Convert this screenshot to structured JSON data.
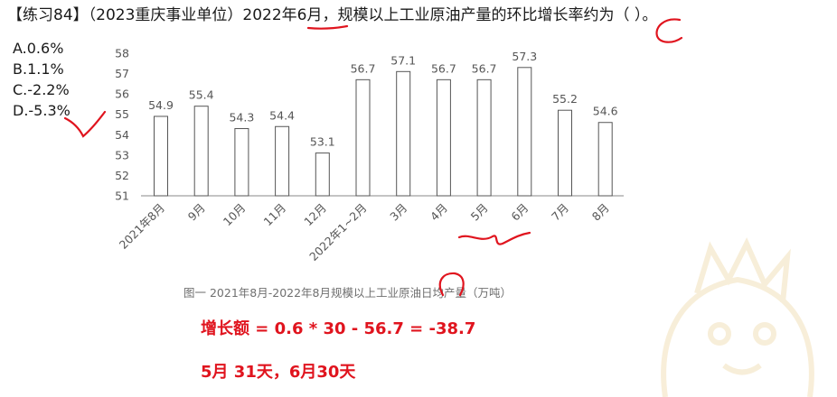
{
  "question": "【练习84】（2023重庆事业单位）2022年6月，规模以上工业原油产量的环比增长率约为（ ）。",
  "options": [
    "A.0.6%",
    "B.1.1%",
    "C.-2.2%",
    "D.-5.3%"
  ],
  "annotations": {
    "note1": "增长额 = 0.6 * 30 - 56.7 = -38.7",
    "note2": "5月 31天，6月30天",
    "color": "#e0141e"
  },
  "chart_data": {
    "type": "bar",
    "title": "图一  2021年8月-2022年8月规模以上工业原油日均产量（万吨）",
    "categories": [
      "2021年8月",
      "9月",
      "10月",
      "11月",
      "12月",
      "2022年1~2月",
      "3月",
      "4月",
      "5月",
      "6月",
      "7月",
      "8月"
    ],
    "values": [
      54.9,
      55.4,
      54.3,
      54.4,
      53.1,
      56.7,
      57.1,
      56.7,
      56.7,
      57.3,
      55.2,
      54.6
    ],
    "data_labels": [
      "54.9",
      "55.4",
      "54.3",
      "54.4",
      "53.1",
      "56.7",
      "57.1",
      "56.7",
      "56.7",
      "57.3",
      "55.2",
      "54.6"
    ],
    "ylim": [
      51,
      58
    ],
    "yticks": [
      "51",
      "52",
      "53",
      "54",
      "55",
      "56",
      "57",
      "58"
    ],
    "grid": false,
    "bar_fill": "#ffffff",
    "bar_stroke": "#555555"
  }
}
